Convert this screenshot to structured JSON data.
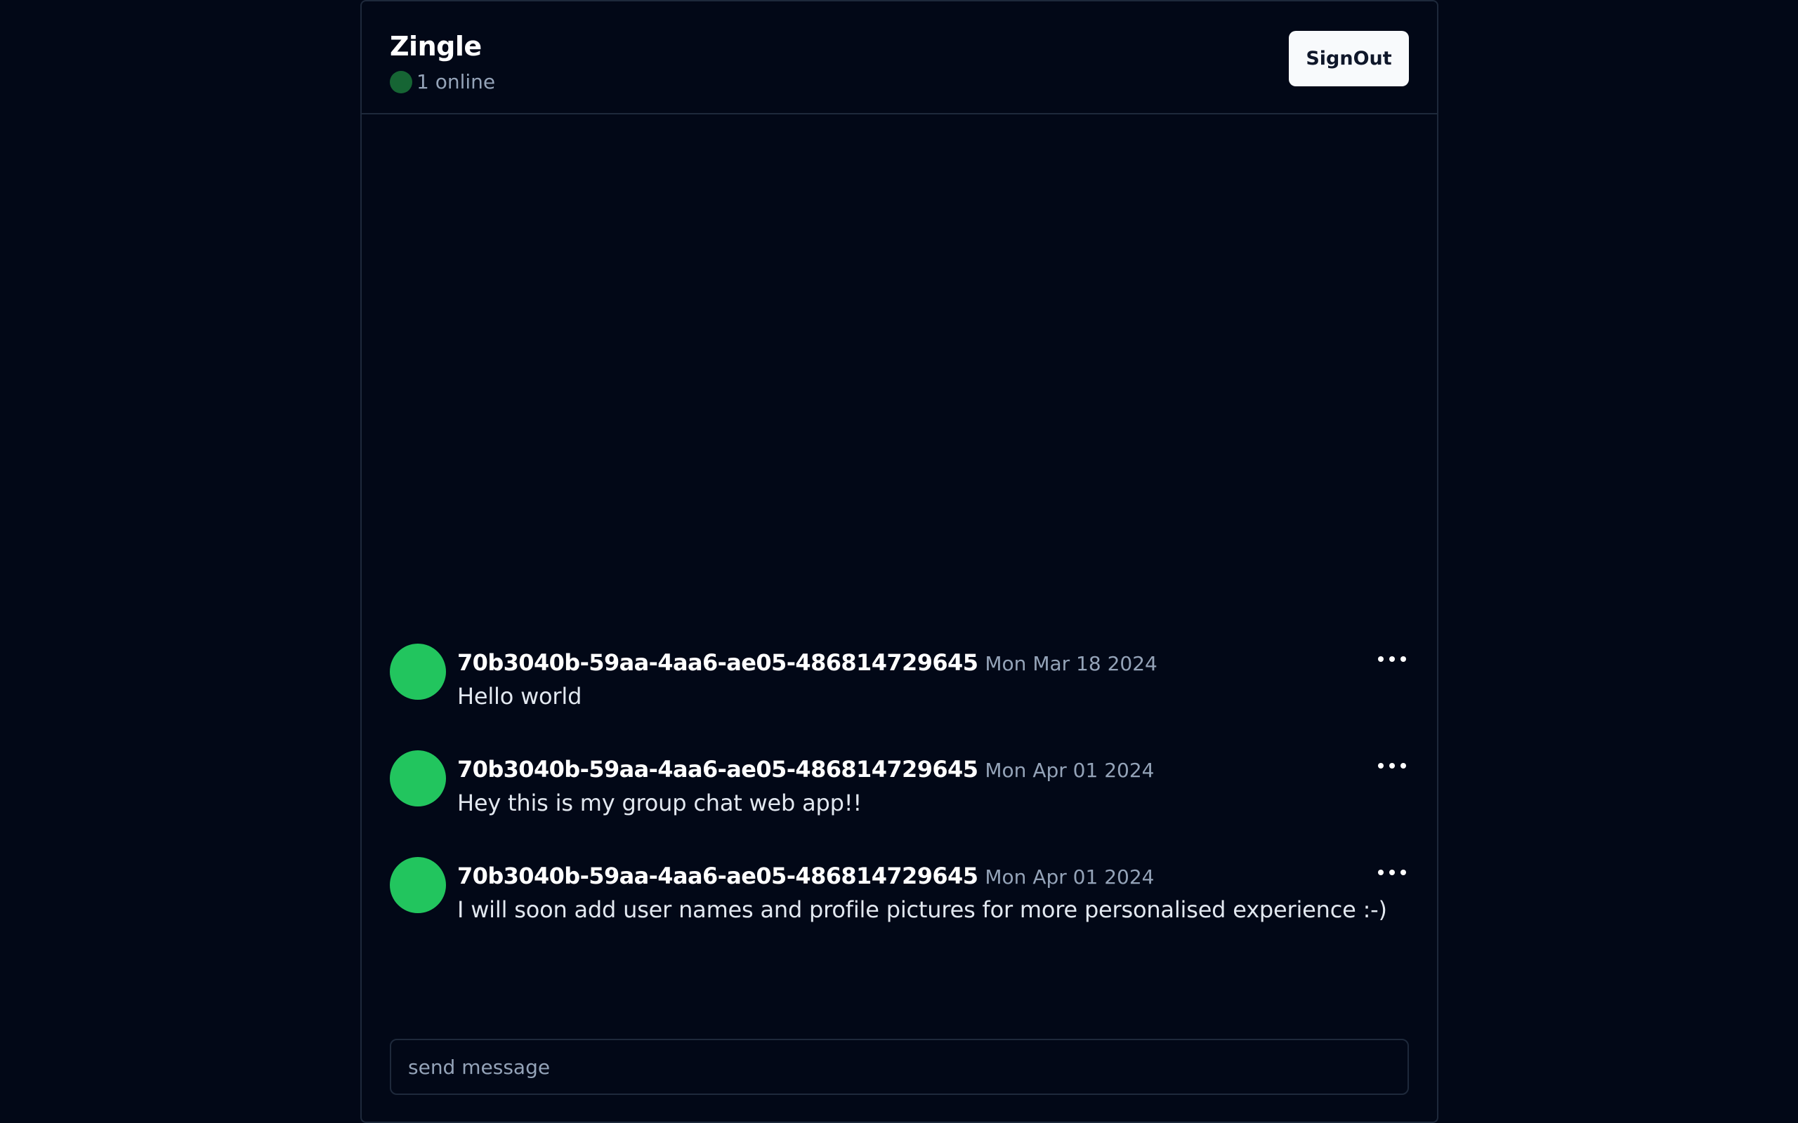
{
  "header": {
    "title": "Zingle",
    "online_text": "1 online",
    "signout_label": "SignOut"
  },
  "messages": [
    {
      "user": "70b3040b-59aa-4aa6-ae05-486814729645",
      "date": "Mon Mar 18 2024",
      "text": "Hello world"
    },
    {
      "user": "70b3040b-59aa-4aa6-ae05-486814729645",
      "date": "Mon Apr 01 2024",
      "text": "Hey this is my group chat web app!!"
    },
    {
      "user": "70b3040b-59aa-4aa6-ae05-486814729645",
      "date": "Mon Apr 01 2024",
      "text": "I will soon add user names and profile pictures for more personalised experience :-)"
    }
  ],
  "composer": {
    "placeholder": "send message",
    "value": ""
  },
  "icons": {
    "online": "online-status-dot",
    "more": "more-horizontal-icon"
  },
  "colors": {
    "background": "#020817",
    "border": "#1e293b",
    "avatar": "#22c55e",
    "online_dot": "#166534",
    "muted_text": "#94a3b8"
  }
}
